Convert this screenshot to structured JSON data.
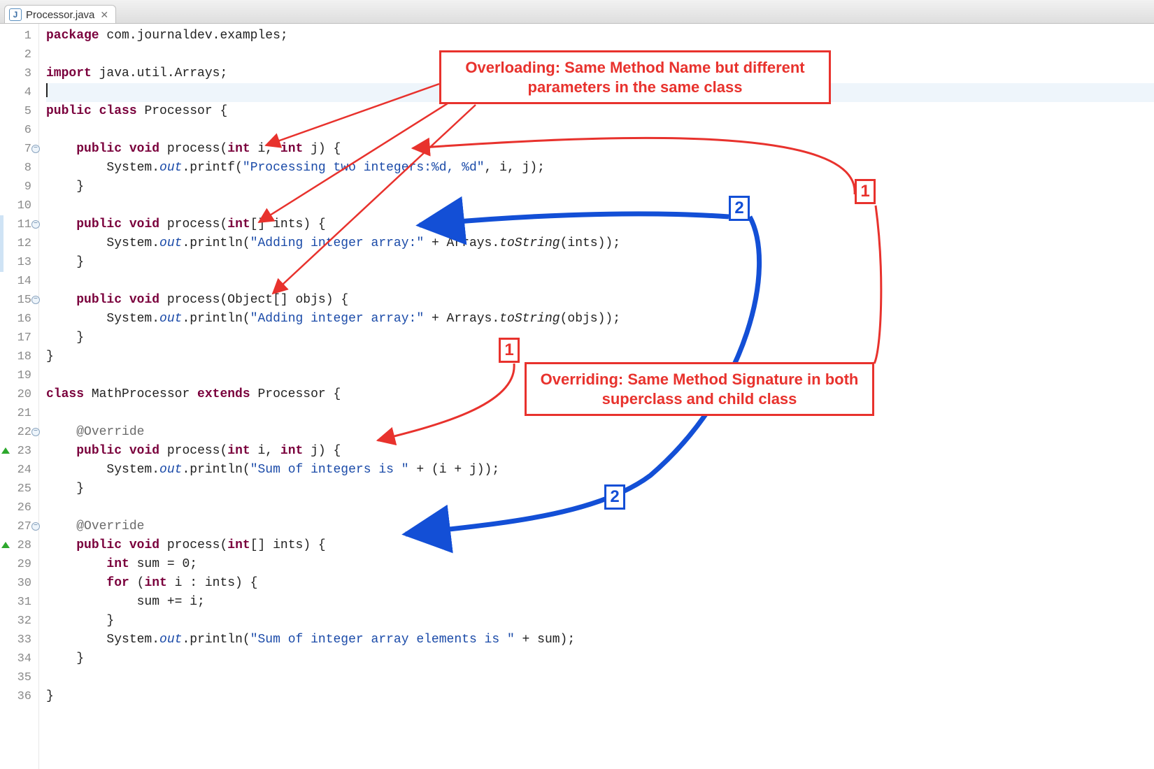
{
  "tab": {
    "filename": "Processor.java",
    "close_glyph": "✕",
    "icon_letter": "J"
  },
  "gutter": {
    "lines": [
      "1",
      "2",
      "3",
      "4",
      "5",
      "6",
      "7",
      "8",
      "9",
      "10",
      "11",
      "12",
      "13",
      "14",
      "15",
      "16",
      "17",
      "18",
      "19",
      "20",
      "21",
      "22",
      "23",
      "24",
      "25",
      "26",
      "27",
      "28",
      "29",
      "30",
      "31",
      "32",
      "33",
      "34",
      "35",
      "36"
    ],
    "fold_lines": [
      7,
      11,
      15,
      22,
      27
    ],
    "override_lines": [
      23,
      28
    ],
    "change_lines": [
      11,
      12,
      13
    ],
    "highlight_line": 4
  },
  "tokens": {
    "kw_package": "package",
    "pkg_name": " com.journaldev.examples;",
    "kw_import": "import",
    "import_stmt": " java.util.Arrays;",
    "kw_public": "public",
    "kw_class": "class",
    "cls_processor": " Processor {",
    "kw_void": "void",
    "m_process": " process",
    "sig_int_int": "(",
    "kw_int": "int",
    "i_param": " i, ",
    "j_param": " j) {",
    "sys": "System.",
    "out": "out",
    "dot": ".",
    "printf": "printf(",
    "str1": "\"Processing two integers:%d, %d\"",
    "printf_tail": ", i, j);",
    "close_brace": "}",
    "sig_int_arr": "(",
    "int_arr": "[] ints) {",
    "println": "println(",
    "str2": "\"Adding integer array:\"",
    "plus_arrays": " + Arrays.",
    "toString": "toString",
    "toString_ints": "(ints));",
    "sig_obj_arr": "(Object[] objs) {",
    "toString_objs": "(objs));",
    "kw_extends": "extends",
    "cls_math": " MathProcessor ",
    "extends_proc": " Processor {",
    "ann_override": "@Override",
    "str_sum": "\"Sum of integers is \"",
    "plus_ij": " + (i + j));",
    "sum_decl_a": " sum = ",
    "zero": "0",
    "semi": ";",
    "kw_for": "for",
    "for_open": " (",
    "for_i": " i : ints) {",
    "sum_plus": "sum += i;",
    "str_arr_sum": "\"Sum of integer array elements is \"",
    "plus_sum": " + sum);"
  },
  "annotations": {
    "overloading": "Overloading: Same Method Name but different parameters in the same class",
    "overriding": "Overriding: Same Method Signature in both superclass and child class",
    "badge1": "1",
    "badge2": "2"
  },
  "colors": {
    "red": "#e8322d",
    "blue": "#134fd6"
  }
}
